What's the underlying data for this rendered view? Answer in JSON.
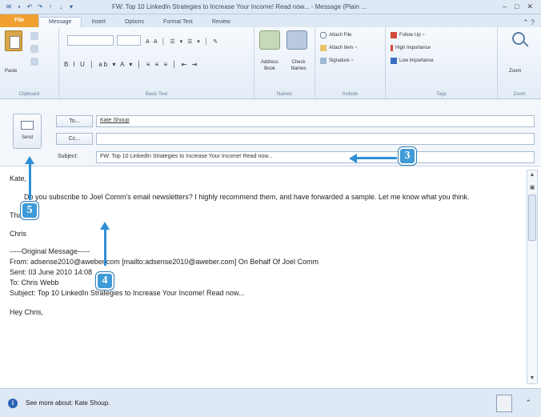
{
  "window": {
    "title": "FW: Top 10 LinkedIn Strategies to Increase Your Income! Read now... - Message (Plain ..."
  },
  "ribbon": {
    "tabs": [
      {
        "label": "File"
      },
      {
        "label": "Message"
      },
      {
        "label": "Insert"
      },
      {
        "label": "Options"
      },
      {
        "label": "Format Text"
      },
      {
        "label": "Review"
      }
    ],
    "groups": {
      "clipboard": "Clipboard",
      "basic_text": "Basic Text",
      "names": "Names",
      "include": "Include",
      "tags": "Tags",
      "zoom": "Zoom"
    },
    "paste_label": "Paste",
    "address_book_label": "Address Book",
    "check_names_label": "Check Names",
    "attach_file_label": "Attach File",
    "attach_item_label": "Attach Item ~",
    "signature_label": "Signature ~",
    "follow_up_label": "Follow Up ~",
    "high_importance_label": "High Importance",
    "low_importance_label": "Low Importance",
    "zoom_label": "Zoom"
  },
  "compose": {
    "send_label": "Send",
    "to_button": "To...",
    "cc_button": "Cc...",
    "subject_label": "Subject:",
    "to_value": "Kate Shoup",
    "cc_value": "",
    "subject_value": "FW: Top 10 LinkedIn Strategies to Increase Your Income! Read now..."
  },
  "body": {
    "greeting": "Kate,",
    "line1": "Do you subscribe to Joel Comm's email newsletters? I highly recommend them, and have forwarded a sample. Let me know what you think.",
    "thanks": "Thanks,",
    "signature": "Chris",
    "original_header": "-----Original Message-----",
    "from_line": "From: adsense2010@aweber.com [mailto:adsense2010@aweber.com] On Behalf Of Joel Comm",
    "sent_line": "Sent: 03 June 2010 14:08",
    "to_line": "To: Chris Webb",
    "subject_line": "Subject: Top 10 LinkedIn Strategies to Increase Your Income! Read now...",
    "hey_line": "Hey Chris,"
  },
  "people_pane": {
    "text": "See more about: Kate Shoup."
  },
  "callouts": {
    "three": "3",
    "four": "4",
    "five": "5"
  },
  "colors": {
    "callout": "#3f9ad8",
    "file_tab": "#f0a030",
    "ribbon_bg": "#e3ecf7"
  }
}
